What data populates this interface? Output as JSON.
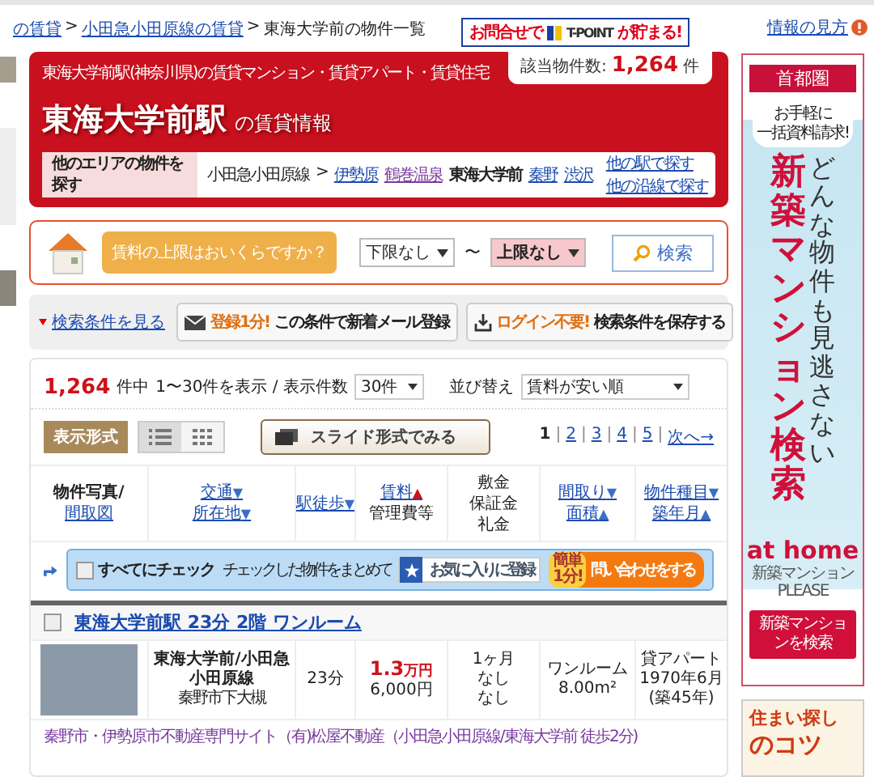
{
  "breadcrumb": {
    "separator": ">",
    "items": [
      {
        "label": "の賃貸",
        "link": true
      },
      {
        "label": "小田急小田原線の賃貸",
        "link": true
      },
      {
        "label": "東海大学前の物件一覧",
        "link": false
      }
    ]
  },
  "info_link": "情報の見方",
  "tpoint_banner": {
    "prefix": "お問合せで",
    "brand": "T-POINT",
    "suffix": "が貯まる!"
  },
  "count_box": {
    "label": "該当物件数:",
    "count": "1,264",
    "unit": "件"
  },
  "hero": {
    "subtitle": "東海大学前駅(神奈川県)の賃貸マンション・賃貸アパート・賃貸住宅",
    "title": "東海大学前駅",
    "title_suffix": "の賃貸情報",
    "area_label": "他のエリアの物件を探す",
    "line": "小田急小田原線",
    "line_sep": ">",
    "stations": [
      {
        "label": "伊勢原",
        "current": false
      },
      {
        "label": "鶴巻温泉",
        "current": false
      },
      {
        "label": "東海大学前",
        "current": true
      },
      {
        "label": "秦野",
        "current": false
      },
      {
        "label": "渋沢",
        "current": false
      }
    ],
    "links": [
      "他の駅で探す",
      "他の沿線で探す"
    ]
  },
  "rent_search": {
    "question": "賃料の上限はおいくらですか？",
    "min": "下限なし",
    "tilde": "〜",
    "max": "上限なし",
    "button": "検索"
  },
  "toolbar": {
    "conditions_link": "検索条件を見る",
    "mail": {
      "highlight": "登録1分!",
      "text": "この条件で新着メール登録"
    },
    "save": {
      "highlight": "ログイン不要!",
      "text": "検索条件を保存する"
    }
  },
  "results": {
    "count": "1,264",
    "count_suffix": "件中",
    "range": "1〜30件を表示 / 表示件数",
    "per_page": "30件",
    "sort_label": "並び替え",
    "sort": "賃料が安い順",
    "view_label": "表示形式",
    "views": [
      {
        "kind": "list",
        "selected": true
      },
      {
        "kind": "grid",
        "selected": false
      }
    ],
    "slide_button": "スライド形式でみる",
    "pages": [
      {
        "label": "1",
        "selected": true
      },
      {
        "label": "2",
        "selected": false
      },
      {
        "label": "3",
        "selected": false
      },
      {
        "label": "4",
        "selected": false
      },
      {
        "label": "5",
        "selected": false
      }
    ],
    "page_separator": "|",
    "next": "次へ→"
  },
  "columns": [
    {
      "lines": [
        {
          "text": "物件写真/",
          "link": false
        },
        {
          "text": "間取図",
          "link": true
        }
      ]
    },
    {
      "lines": [
        {
          "text": "交通",
          "link": true,
          "arrow": "▼",
          "selected": false
        },
        {
          "text": "所在地",
          "link": true,
          "arrow": "▼",
          "selected": false
        }
      ]
    },
    {
      "lines": [
        {
          "text": "駅徒歩",
          "link": true,
          "arrow": "▼",
          "selected": false
        }
      ]
    },
    {
      "lines": [
        {
          "text": "賃料",
          "link": true,
          "arrow": "▲",
          "selected": true
        },
        {
          "text": "管理費等",
          "link": false
        }
      ]
    },
    {
      "lines": [
        {
          "text": "敷金",
          "link": false
        },
        {
          "text": "保証金",
          "link": false
        },
        {
          "text": "礼金",
          "link": false
        }
      ]
    },
    {
      "lines": [
        {
          "text": "間取り",
          "link": true,
          "arrow": "▼",
          "selected": false
        },
        {
          "text": "面積",
          "link": true,
          "arrow": "▲",
          "selected": false
        }
      ]
    },
    {
      "lines": [
        {
          "text": "物件種目",
          "link": true,
          "arrow": "▼",
          "selected": false
        },
        {
          "text": "築年月",
          "link": true,
          "arrow": "▲",
          "selected": false
        }
      ]
    }
  ],
  "bulk_bar": {
    "check_label": "すべてにチェック",
    "checked": false,
    "note": "チェックした物件をまとめて",
    "favorite": "お気に入りに登録",
    "badge": [
      "簡単",
      "1分!"
    ],
    "inquiry": "問い合わせをする"
  },
  "listing": {
    "checked": false,
    "title": "東海大学前駅 23分 2階 ワンルーム",
    "station": "東海大学前/小田急小田原線",
    "address": "秦野市下大槻",
    "walk": "23分",
    "rent": "1.3",
    "rent_unit": "万円",
    "fee": "6,000円",
    "deposits": [
      "1ヶ月",
      "なし",
      "なし"
    ],
    "layout": "ワンルーム",
    "area": "8.00m²",
    "type": "貸アパート",
    "built": "1970年6月",
    "age": "(築45年)",
    "agent": "秦野市・伊勢原市不動産専門サイト（有)松屋不動産（小田急小田原線/東海大学前 徒歩2分)"
  },
  "ad": {
    "region": "首都圏",
    "bubble": [
      "お手軽に",
      "一括資料請求!"
    ],
    "vertical_small": "どんな物件も見逃さない",
    "vertical_big": "新築マンション検索",
    "brand": "at home",
    "brand_sub": "新築マンション PLEASE",
    "button": "新築マンションを検索"
  },
  "ad2": {
    "title": [
      "住まい探し",
      "のコツ"
    ]
  }
}
